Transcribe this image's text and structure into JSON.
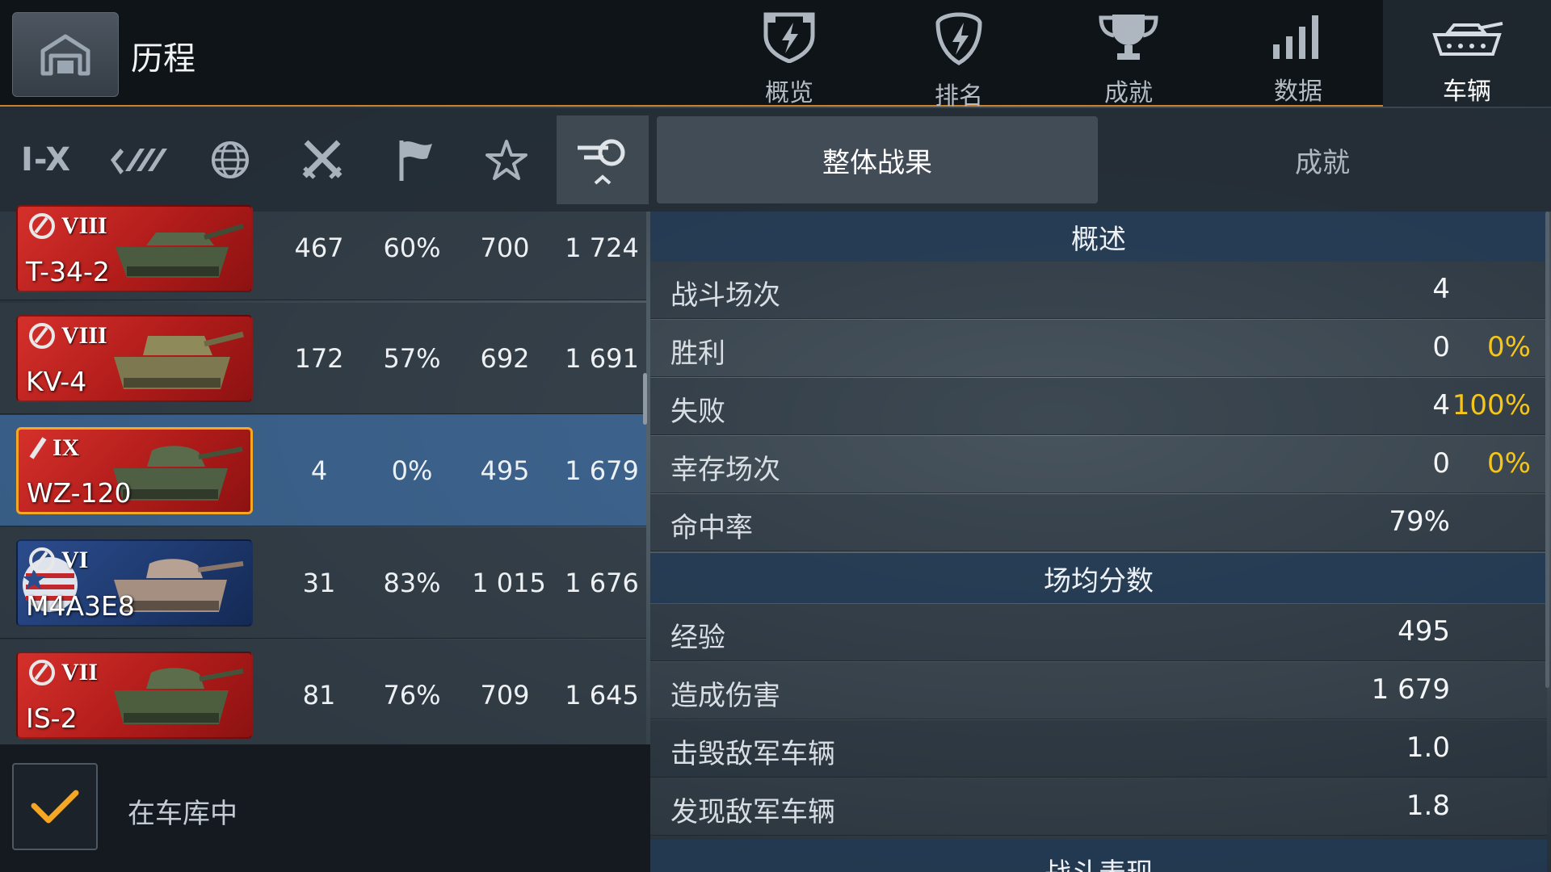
{
  "header": {
    "title": "历程",
    "nav_tabs": [
      {
        "label": "概览",
        "icon": "shield-bolt-icon",
        "active": false
      },
      {
        "label": "排名",
        "icon": "rank-bolt-icon",
        "active": false
      },
      {
        "label": "成就",
        "icon": "trophy-icon",
        "active": false
      },
      {
        "label": "数据",
        "icon": "bar-signal-icon",
        "active": false
      },
      {
        "label": "车辆",
        "icon": "tank-icon",
        "active": true
      }
    ]
  },
  "filters": {
    "tier_label": "I-X",
    "icons": [
      "tier-filter",
      "mastery-icon",
      "nation-globe-icon",
      "crossed-swords-icon",
      "flag-icon",
      "star-icon",
      "sort-gun-icon"
    ],
    "active": "sort-gun-icon"
  },
  "vehicles": [
    {
      "tier": "VIII",
      "name": "T-34-2",
      "nation": "china",
      "battles": "467",
      "win_rate": "60%",
      "avg_exp": "700",
      "avg_damage": "1 724",
      "selected": false
    },
    {
      "tier": "VIII",
      "name": "KV-4",
      "nation": "ussr",
      "battles": "172",
      "win_rate": "57%",
      "avg_exp": "692",
      "avg_damage": "1 691",
      "selected": false
    },
    {
      "tier": "IX",
      "name": "WZ-120",
      "nation": "china",
      "battles": "4",
      "win_rate": "0%",
      "avg_exp": "495",
      "avg_damage": "1 679",
      "selected": true
    },
    {
      "tier": "VI",
      "name": "M4A3E8",
      "nation": "usa",
      "battles": "31",
      "win_rate": "83%",
      "avg_exp": "1 015",
      "avg_damage": "1 676",
      "selected": false
    },
    {
      "tier": "VII",
      "name": "IS-2",
      "nation": "ussr",
      "battles": "81",
      "win_rate": "76%",
      "avg_exp": "709",
      "avg_damage": "1 645",
      "selected": false
    }
  ],
  "garage_filter": {
    "label": "在车库中",
    "checked": true
  },
  "right_tabs": [
    {
      "label": "整体战果",
      "active": true
    },
    {
      "label": "成就",
      "active": false
    }
  ],
  "stats": {
    "overview": {
      "header": "概述",
      "rows": [
        {
          "label": "战斗场次",
          "value": "4",
          "pct": ""
        },
        {
          "label": "胜利",
          "value": "0",
          "pct": "0%"
        },
        {
          "label": "失败",
          "value": "4",
          "pct": "100%"
        },
        {
          "label": "幸存场次",
          "value": "0",
          "pct": "0%"
        },
        {
          "label": "命中率",
          "value": "79%",
          "pct": ""
        }
      ]
    },
    "averages": {
      "header": "场均分数",
      "rows": [
        {
          "label": "经验",
          "value": "495"
        },
        {
          "label": "造成伤害",
          "value": "1 679"
        },
        {
          "label": "击毁敌军车辆",
          "value": "1.0"
        },
        {
          "label": "发现敌军车辆",
          "value": "1.8"
        }
      ]
    },
    "performance": {
      "header": "战斗表现"
    }
  },
  "colors": {
    "accent": "#c9812e",
    "selected_row": "#3a628e",
    "selected_card_border": "#f5a623",
    "percent": "#f5c518",
    "check": "#f5a623"
  }
}
